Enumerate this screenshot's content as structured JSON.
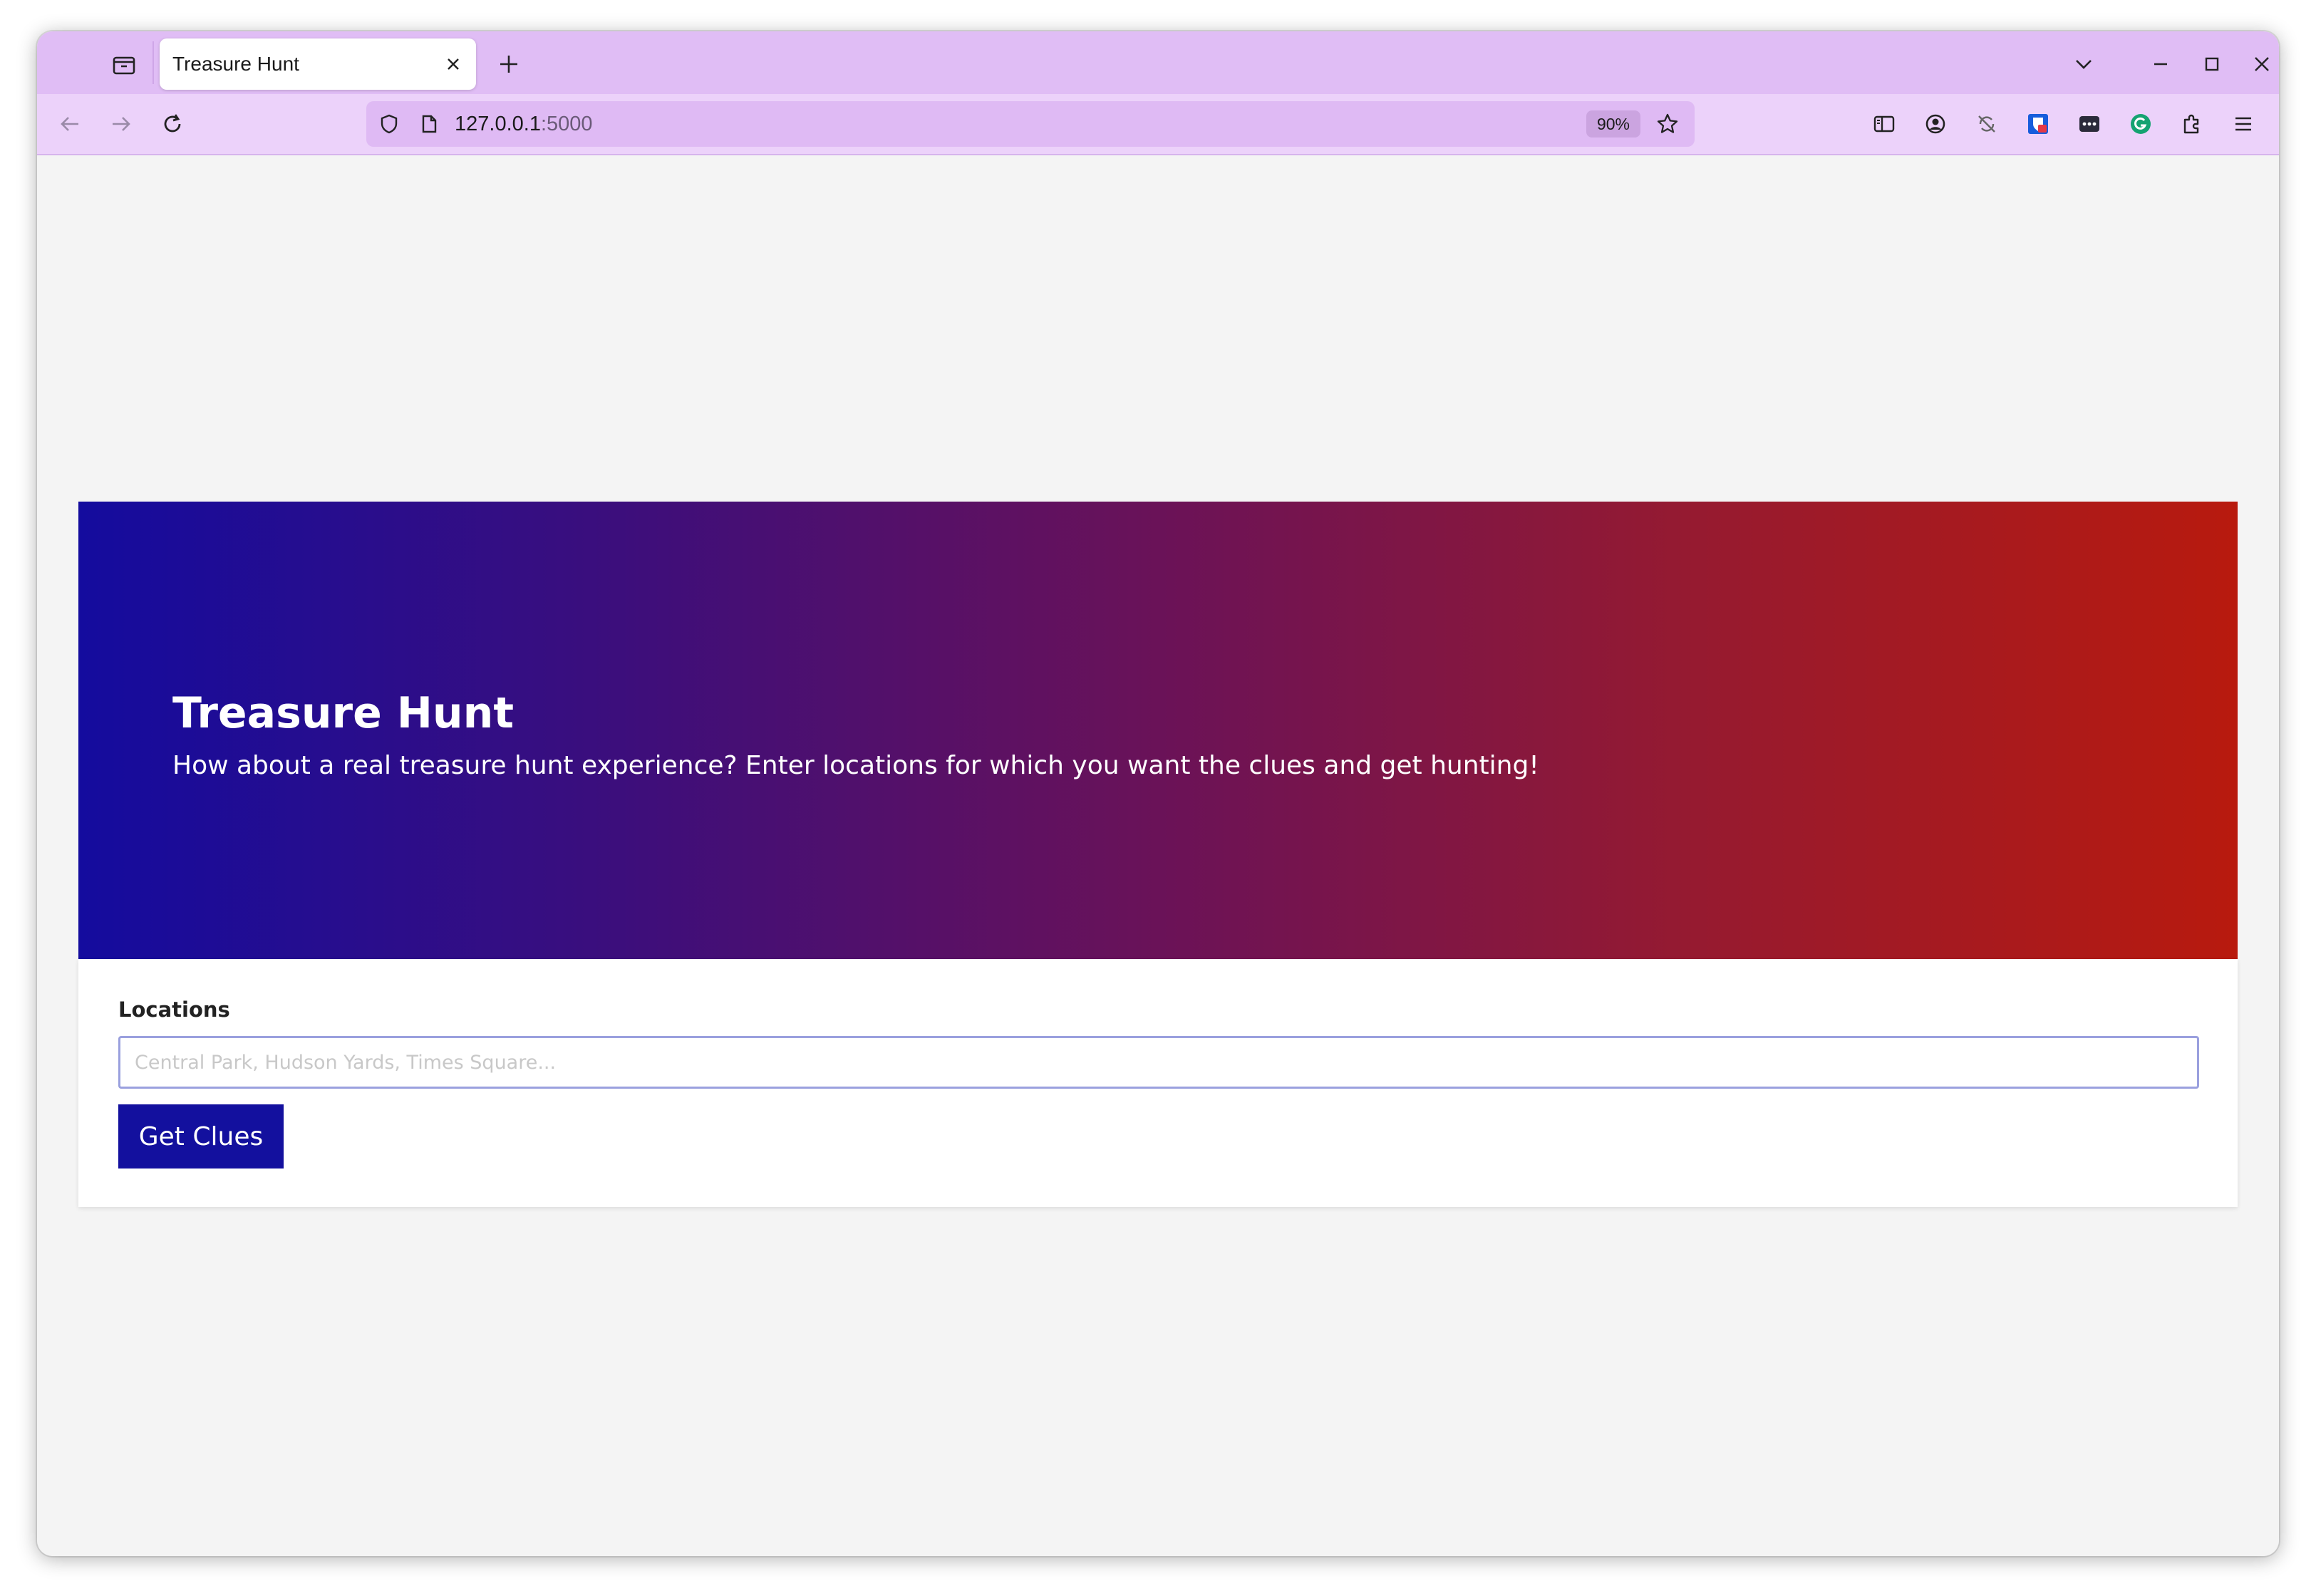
{
  "browser": {
    "tab_title": "Treasure Hunt",
    "url_host": "127.0.0.1",
    "url_port": ":5000",
    "zoom": "90%",
    "icons": {
      "tab_list": "tab-list-icon",
      "close_tab": "close-icon",
      "new_tab": "plus-icon",
      "list_all_tabs": "chevron-down-icon",
      "minimize": "minimize-icon",
      "maximize": "maximize-icon",
      "close_window": "close-icon",
      "back": "back-arrow-icon",
      "forward": "forward-arrow-icon",
      "reload": "reload-icon",
      "tracking_protection": "shield-icon",
      "page_info": "page-icon",
      "bookmark": "star-icon",
      "reader_view": "sidebar-icon",
      "account": "account-icon",
      "extension_1": "no-sync-icon",
      "extension_2": "bitwarden-icon",
      "extension_3": "password-dots-icon",
      "extension_4": "grammarly-icon",
      "extensions": "puzzle-icon",
      "menu": "hamburger-menu-icon"
    },
    "colors": {
      "tabbar": "#e0bdf5",
      "navbar": "#ecd2fa",
      "urlbar": "#dfbaf4"
    }
  },
  "page": {
    "hero": {
      "title": "Treasure Hunt",
      "subtitle": "How about a real treasure hunt experience? Enter locations for which you want the clues and get hunting!",
      "gradient_start": "#140c9e",
      "gradient_end": "#b81a0e"
    },
    "form": {
      "locations_label": "Locations",
      "locations_placeholder": "Central Park, Hudson Yards, Times Square...",
      "locations_value": "",
      "submit_label": "Get Clues",
      "submit_color": "#13109e"
    }
  }
}
